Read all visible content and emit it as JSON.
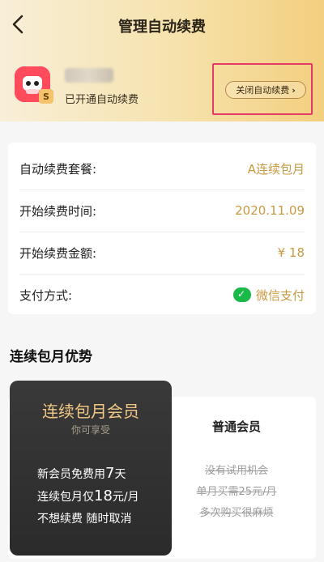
{
  "header": {
    "title": "管理自动续费",
    "back_icon": "chevron-left-icon",
    "user": {
      "status": "已开通自动续费",
      "badge": "S"
    },
    "close_auto_renew_label": "关闭自动续费",
    "close_auto_renew_chevron": "›"
  },
  "details": {
    "rows": [
      {
        "label": "自动续费套餐:",
        "value": "A连续包月"
      },
      {
        "label": "开始续费时间:",
        "value": "2020.11.09"
      },
      {
        "label": "开始续费金额:",
        "value": "¥ 18"
      },
      {
        "label": "支付方式:",
        "value": "微信支付"
      }
    ],
    "colors": {
      "accent": "#c79a42",
      "wechat": "#19b94a"
    }
  },
  "section": {
    "title": "连续包月优势"
  },
  "compare": {
    "vip": {
      "title": "连续包月会员",
      "subtitle": "你可享受",
      "line1_prefix": "新会员免费用",
      "line1_num": "7",
      "line1_suffix": "天",
      "line2_prefix": "连续包月仅",
      "line2_num": "18",
      "line2_suffix": "元/月",
      "line3": "不想续费 随时取消"
    },
    "normal": {
      "title": "普通会员",
      "lines": [
        "没有试用机会",
        "单月买需25元/月",
        "多次购买很麻烦"
      ]
    }
  }
}
